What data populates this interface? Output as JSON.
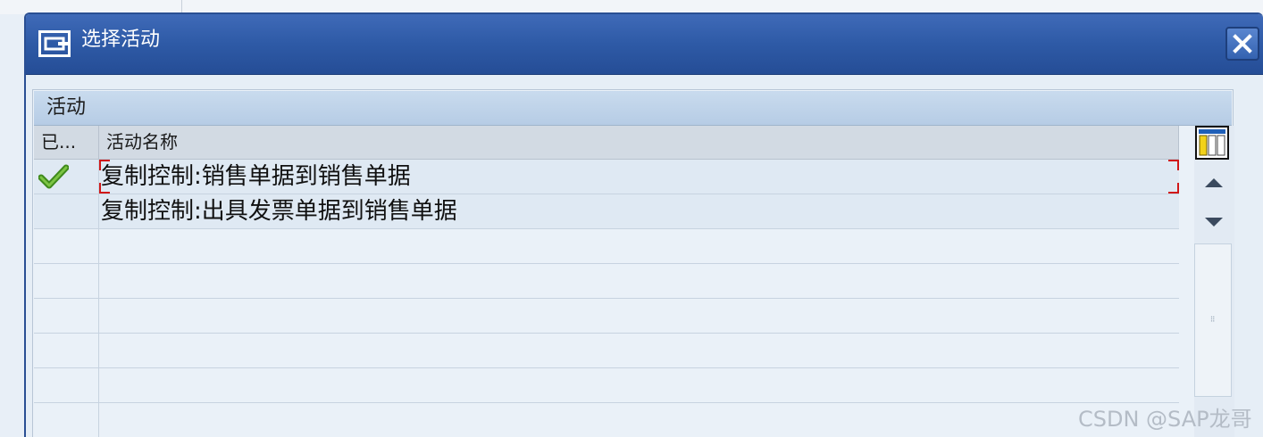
{
  "dialog": {
    "title": "选择活动",
    "close_icon": "close-icon"
  },
  "panel": {
    "title": "活动"
  },
  "table": {
    "columns": [
      "已...",
      "活动名称"
    ],
    "rows": [
      {
        "done": true,
        "name": "复制控制:销售单据到销售单据",
        "focused": true
      },
      {
        "done": false,
        "name": "复制控制:出具发票单据到销售单据",
        "focused": false
      }
    ]
  },
  "watermark": "CSDN @SAP龙哥",
  "colors": {
    "title_bar": "#2e5aa6",
    "panel_header": "#c0d4ea",
    "check": "#5aa828",
    "focus_marker": "#d01818"
  }
}
